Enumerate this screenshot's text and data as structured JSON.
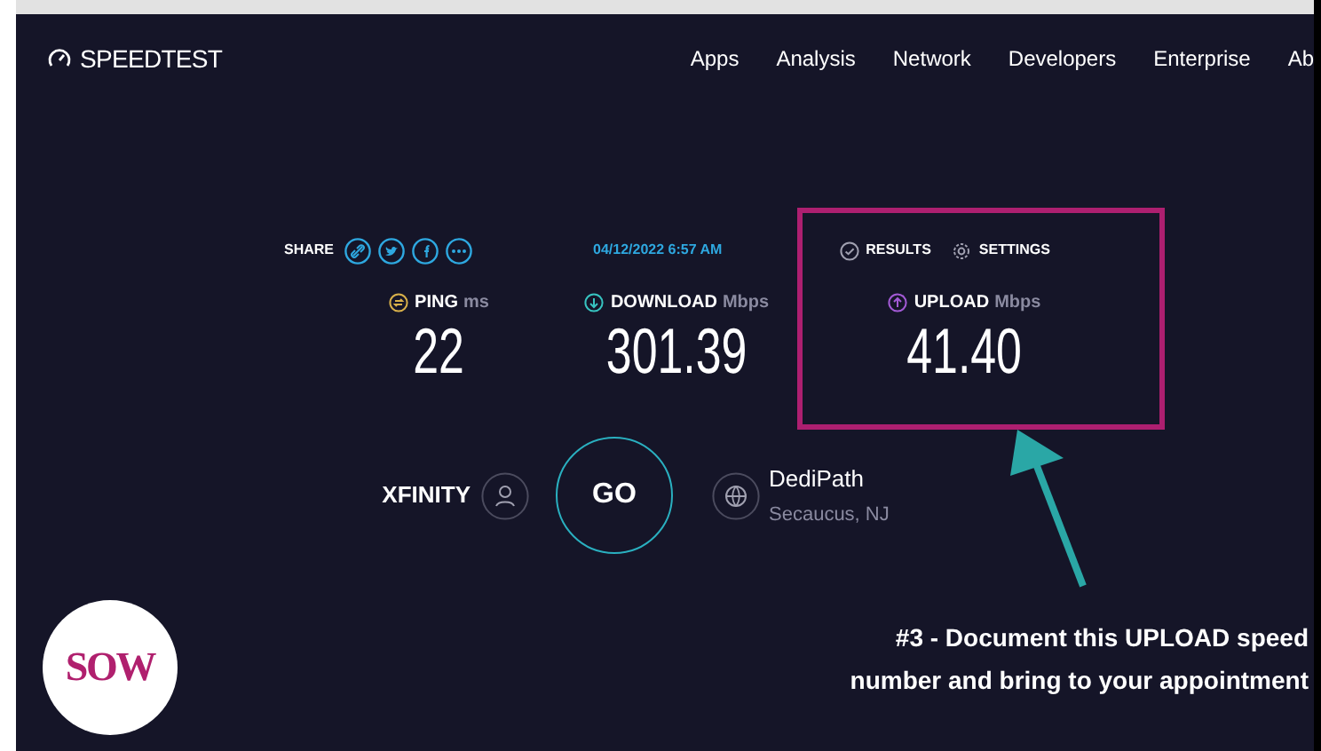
{
  "header": {
    "logo": "SPEEDTEST",
    "nav": [
      "Apps",
      "Analysis",
      "Network",
      "Developers",
      "Enterprise",
      "Ab"
    ]
  },
  "result": {
    "share_label": "SHARE",
    "date": "04/12/2022 6:57 AM",
    "links": [
      "RESULTS",
      "SETTINGS"
    ],
    "metrics": [
      {
        "kind": "ping",
        "label": "PING",
        "unit": "ms",
        "value": "22",
        "color": "#d8b04a"
      },
      {
        "kind": "download",
        "label": "DOWNLOAD",
        "unit": "Mbps",
        "value": "301.39",
        "color": "#37c3c0"
      },
      {
        "kind": "upload",
        "label": "UPLOAD",
        "unit": "Mbps",
        "value": "41.40",
        "color": "#a35ad6"
      }
    ]
  },
  "connection": {
    "isp": "XFINITY",
    "go": "GO",
    "server": "DediPath",
    "location": "Secaucus, NJ"
  },
  "annotation": {
    "text": "#3 - Document this UPLOAD speed number and bring to your appointment",
    "logo": "SOW"
  }
}
